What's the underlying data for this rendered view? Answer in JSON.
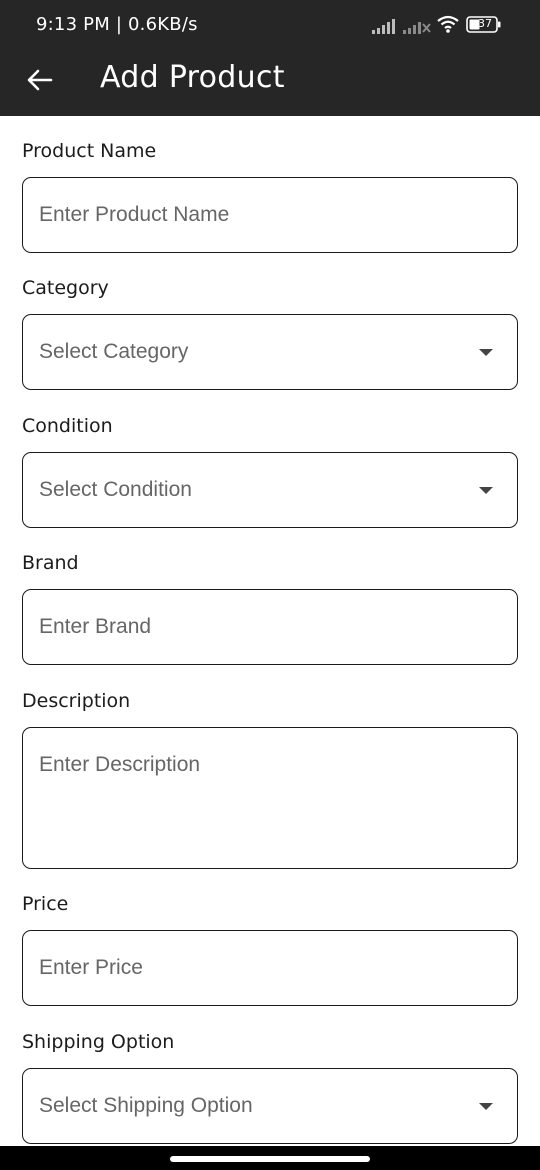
{
  "status_bar": {
    "time_speed": "9:13 PM | 0.6KB/s",
    "battery_level": "37",
    "icons": [
      "signal-icon",
      "signal-no-service-icon",
      "wifi-icon",
      "battery-icon"
    ]
  },
  "app_bar": {
    "title": "Add Product",
    "back_icon": "arrow-left-icon",
    "background": "#262626"
  },
  "form": {
    "product_name": {
      "label": "Product Name",
      "placeholder": "Enter Product Name"
    },
    "category": {
      "label": "Category",
      "value": "Select Category"
    },
    "condition": {
      "label": "Condition",
      "value": "Select Condition"
    },
    "brand": {
      "label": "Brand",
      "placeholder": "Enter Brand"
    },
    "description": {
      "label": "Description",
      "placeholder": "Enter Description"
    },
    "price": {
      "label": "Price",
      "placeholder": "Enter Price"
    },
    "shipping_option": {
      "label": "Shipping Option",
      "value": "Select Shipping Option"
    }
  }
}
